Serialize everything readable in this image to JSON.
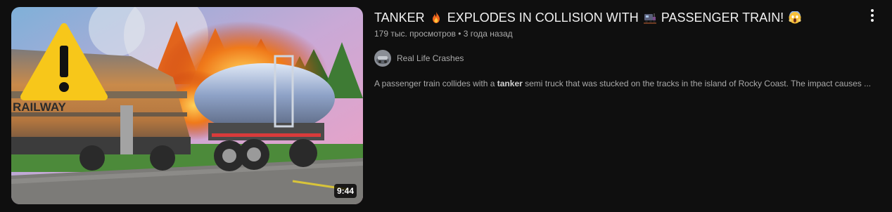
{
  "video": {
    "duration": "9:44",
    "title_part1": "TANKER",
    "title_emoji1": "fire-emoji",
    "title_part2": "EXPLODES IN COLLISION WITH",
    "title_emoji2": "train-emoji",
    "title_part3": "PASSENGER TRAIN!",
    "title_emoji3": "screaming-face-emoji",
    "views": "179 тыс. просмотров",
    "separator": "•",
    "age": "3 года назад",
    "channel": "Real Life Crashes",
    "description_before": "A passenger train collides with a ",
    "description_bold": "tanker",
    "description_after": " semi truck that was stucked on the tracks in the island of Rocky Coast. The impact causes ...",
    "thumbnail_text": "RAILWAY"
  },
  "icons": {
    "menu": "more-vert-icon",
    "warning": "warning-icon"
  },
  "colors": {
    "background": "#0f0f0f",
    "primary_text": "#f1f1f1",
    "secondary_text": "#aaaaaa",
    "warning_yellow": "#f7c71a"
  }
}
